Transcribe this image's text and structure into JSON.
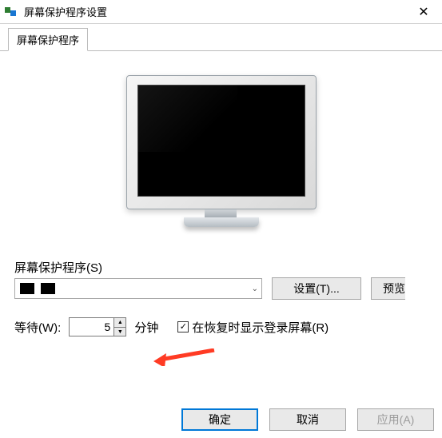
{
  "window": {
    "title": "屏幕保护程序设置",
    "close_glyph": "✕"
  },
  "tab": {
    "label": "屏幕保护程序"
  },
  "section": {
    "label": "屏幕保护程序(S)"
  },
  "combo": {
    "selected_display": "",
    "chevron_glyph": "⌄"
  },
  "buttons": {
    "settings": "设置(T)...",
    "preview_truncated": "预览"
  },
  "wait": {
    "label": "等待(W):",
    "value": "5",
    "unit": "分钟",
    "up_glyph": "▲",
    "down_glyph": "▼"
  },
  "resume": {
    "checked_glyph": "✓",
    "label": "在恢复时显示登录屏幕(R)"
  },
  "footer": {
    "ok": "确定",
    "cancel": "取消",
    "apply": "应用(A)"
  }
}
